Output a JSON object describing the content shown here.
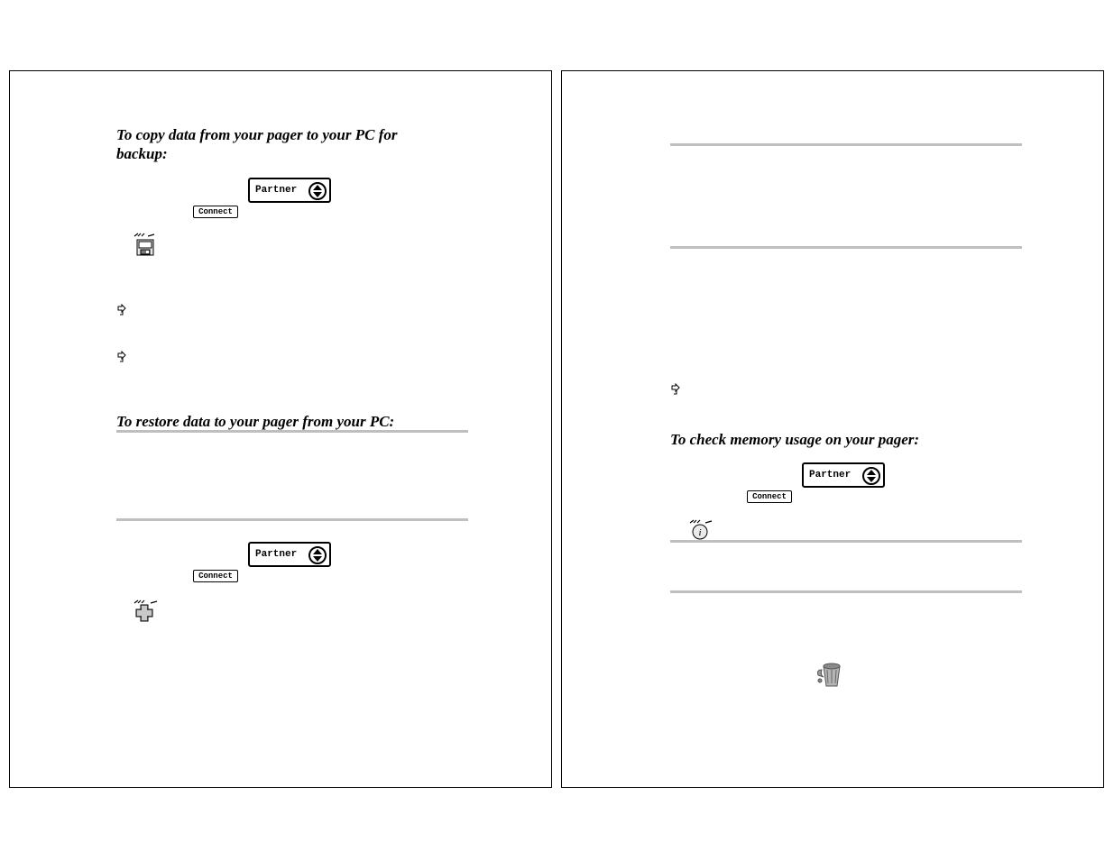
{
  "left": {
    "heading1": "To copy data from your pager to your PC for backup:",
    "partner_label": "Partner",
    "connect_label": "Connect",
    "heading2": "To restore data to your pager from your PC:"
  },
  "right": {
    "heading1": "To check memory usage on your pager:",
    "partner_label": "Partner",
    "connect_label": "Connect"
  }
}
